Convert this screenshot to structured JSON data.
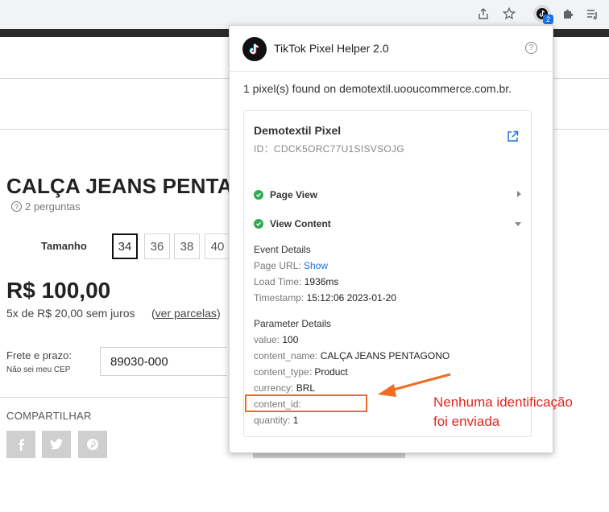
{
  "browser": {
    "extension_badge": "2",
    "icons": [
      "share-icon",
      "bookmark-star-icon",
      "tiktok-extension-icon",
      "puzzle-extensions-icon",
      "reading-list-icon"
    ]
  },
  "product": {
    "title": "CALÇA JEANS PENTAGO",
    "questions": "2 perguntas",
    "size_label": "Tamanho",
    "sizes": [
      "34",
      "36",
      "38",
      "40"
    ],
    "selected_size": "34",
    "price": "R$ 100,00",
    "installments": "5x de R$ 20,00 sem juros",
    "installments_open": "(",
    "installments_link": "ver parcelas",
    "installments_close": ")",
    "freight_label": "Frete e prazo:",
    "freight_sub": "Não sei meu CEP",
    "cep_value": "89030-000",
    "share_label": "COMPARTILHAR"
  },
  "popup": {
    "title": "TikTok Pixel Helper 2.0",
    "found": "1 pixel(s) found on demotextil.uooucommerce.com.br.",
    "pixel": {
      "name": "Demotextil Pixel",
      "id": "ID：CDCK5ORC77U1SISVSOJG"
    },
    "events": [
      {
        "name": "Page View",
        "expanded": false
      },
      {
        "name": "View Content",
        "expanded": true
      }
    ],
    "event_details": {
      "heading": "Event Details",
      "page_url_key": "Page URL:",
      "page_url_value": "Show",
      "load_time_key": "Load Time:",
      "load_time_value": "1936ms",
      "timestamp_key": "Timestamp:",
      "timestamp_value": "15:12:06 2023-01-20"
    },
    "parameter_details": {
      "heading": "Parameter Details",
      "value_key": "value:",
      "value_value": "100",
      "content_name_key": "content_name:",
      "content_name_value": "CALÇA JEANS PENTAGONO",
      "content_type_key": "content_type:",
      "content_type_value": "Product",
      "currency_key": "currency:",
      "currency_value": "BRL",
      "content_id_key": "content_id:",
      "content_id_value": "",
      "quantity_key": "quantity:",
      "quantity_value": "1"
    }
  },
  "annotation": {
    "line1": "Nenhuma identificação",
    "line2": "foi enviada",
    "color": "#e3261f",
    "box_color": "#f26b21"
  }
}
